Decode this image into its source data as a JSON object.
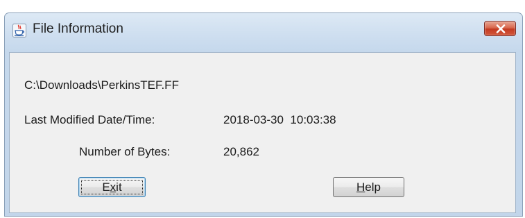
{
  "window": {
    "title": "File Information"
  },
  "file": {
    "path": "C:\\Downloads\\PerkinsTEF.FF",
    "modified_label": "Last Modified Date/Time:",
    "modified_value": "2018-03-30  10:03:38",
    "bytes_label": "Number of Bytes:",
    "bytes_value": "20,862"
  },
  "buttons": {
    "exit": {
      "before": "E",
      "mnemonic": "x",
      "after": "it"
    },
    "help": {
      "before": "",
      "mnemonic": "H",
      "after": "elp"
    }
  },
  "icons": {
    "app": "java-cup-icon",
    "close": "close-icon"
  },
  "colors": {
    "close_button": "#c43b22",
    "frame": "#c5d8ec",
    "client": "#f0f0f0"
  }
}
